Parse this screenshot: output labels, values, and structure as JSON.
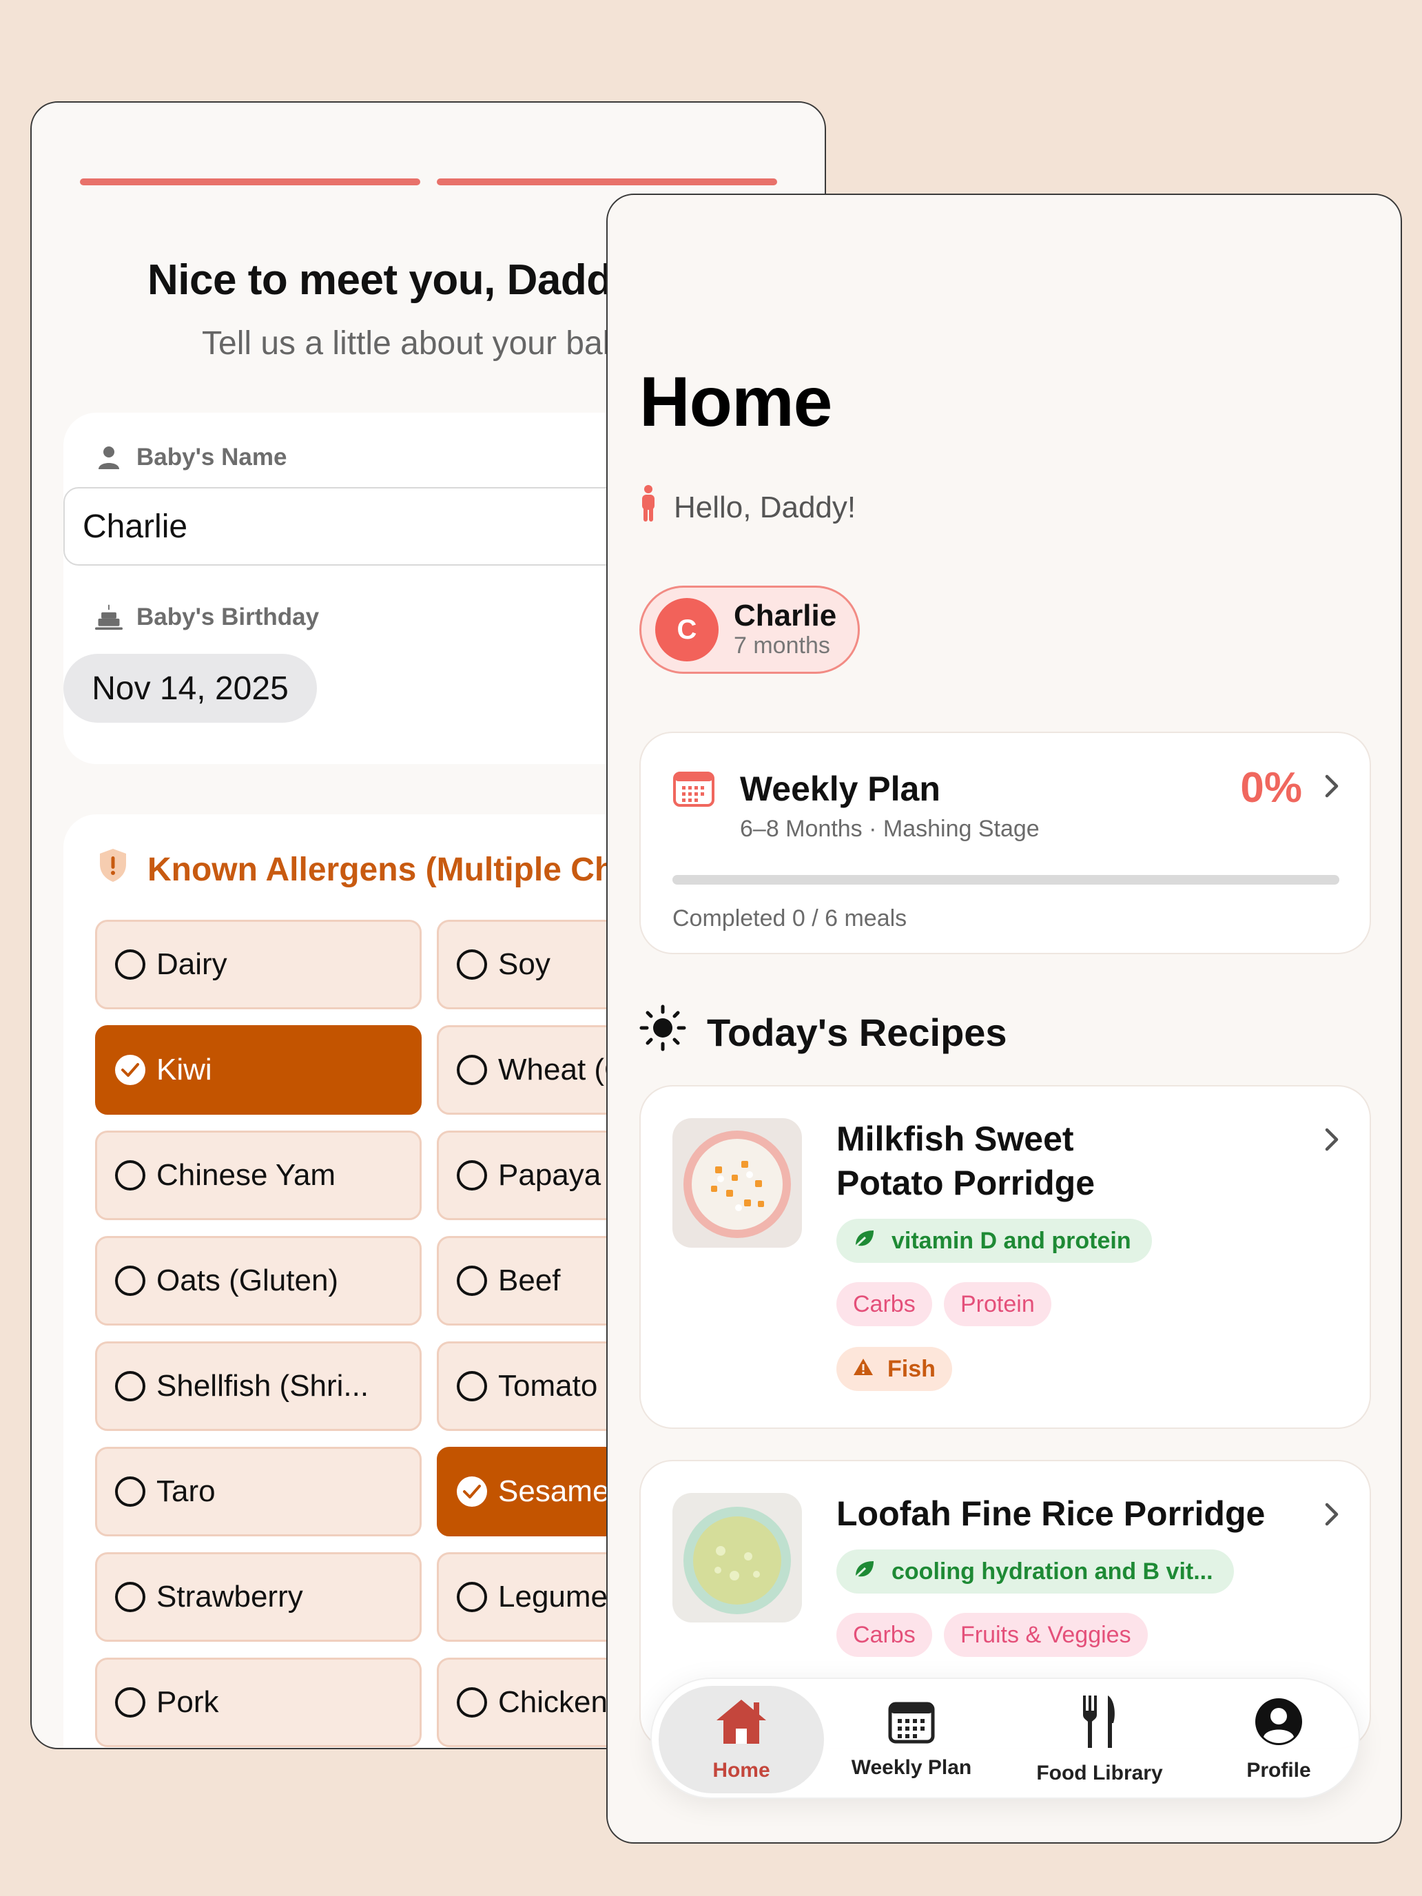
{
  "onboarding": {
    "title": "Nice to meet you, Daddy!",
    "subtitle": "Tell us a little about your baby",
    "name_label": "Baby's Name",
    "name_value": "Charlie",
    "birthday_label": "Baby's Birthday",
    "birthday_value": "Nov 14, 2025",
    "allergens_title": "Known Allergens (Multiple Choice)",
    "allergens": [
      {
        "label": "Dairy",
        "selected": false
      },
      {
        "label": "Soy",
        "selected": false
      },
      {
        "label": "Kiwi",
        "selected": true
      },
      {
        "label": "Wheat (Gluten)",
        "selected": false
      },
      {
        "label": "Chinese Yam",
        "selected": false
      },
      {
        "label": "Papaya",
        "selected": false
      },
      {
        "label": "Oats (Gluten)",
        "selected": false
      },
      {
        "label": "Beef",
        "selected": false
      },
      {
        "label": "Shellfish (Shri...",
        "selected": false
      },
      {
        "label": "Tomato",
        "selected": false
      },
      {
        "label": "Taro",
        "selected": false
      },
      {
        "label": "Sesame",
        "selected": true
      },
      {
        "label": "Strawberry",
        "selected": false
      },
      {
        "label": "Legumes",
        "selected": false
      },
      {
        "label": "Pork",
        "selected": false
      },
      {
        "label": "Chicken",
        "selected": false
      }
    ]
  },
  "home": {
    "title": "Home",
    "greeting": "Hello, Daddy!",
    "baby": {
      "initial": "C",
      "name": "Charlie",
      "age": "7 months"
    },
    "weekly_plan": {
      "title": "Weekly Plan",
      "subtitle": "6–8 Months · Mashing Stage",
      "percent": "0%",
      "progress": 0,
      "completed_text": "Completed 0 / 6 meals"
    },
    "recipes_title": "Today's Recipes",
    "recipes": [
      {
        "name_line1": "Milkfish Sweet",
        "name_line2": "Potato Porridge",
        "benefit": "vitamin D and protein",
        "tags": [
          "Carbs",
          "Protein"
        ],
        "allergen": "Fish"
      },
      {
        "name_line1": "Loofah Fine Rice Porridge",
        "benefit": "cooling hydration and B vit...",
        "tags": [
          "Carbs",
          "Fruits & Veggies"
        ]
      }
    ],
    "tabs": [
      {
        "label": "Home",
        "icon": "house-icon",
        "active": true
      },
      {
        "label": "Weekly Plan",
        "icon": "calendar-icon",
        "active": false
      },
      {
        "label": "Food Library",
        "icon": "fork-knife-icon",
        "active": false
      },
      {
        "label": "Profile",
        "icon": "person-circle-icon",
        "active": false
      }
    ]
  },
  "colors": {
    "background": "#f3e3d6",
    "accent_coral": "#f0675e",
    "allergen_orange": "#c35400",
    "benefit_green": "#1e8a35",
    "tag_pink": "#e4507a"
  }
}
